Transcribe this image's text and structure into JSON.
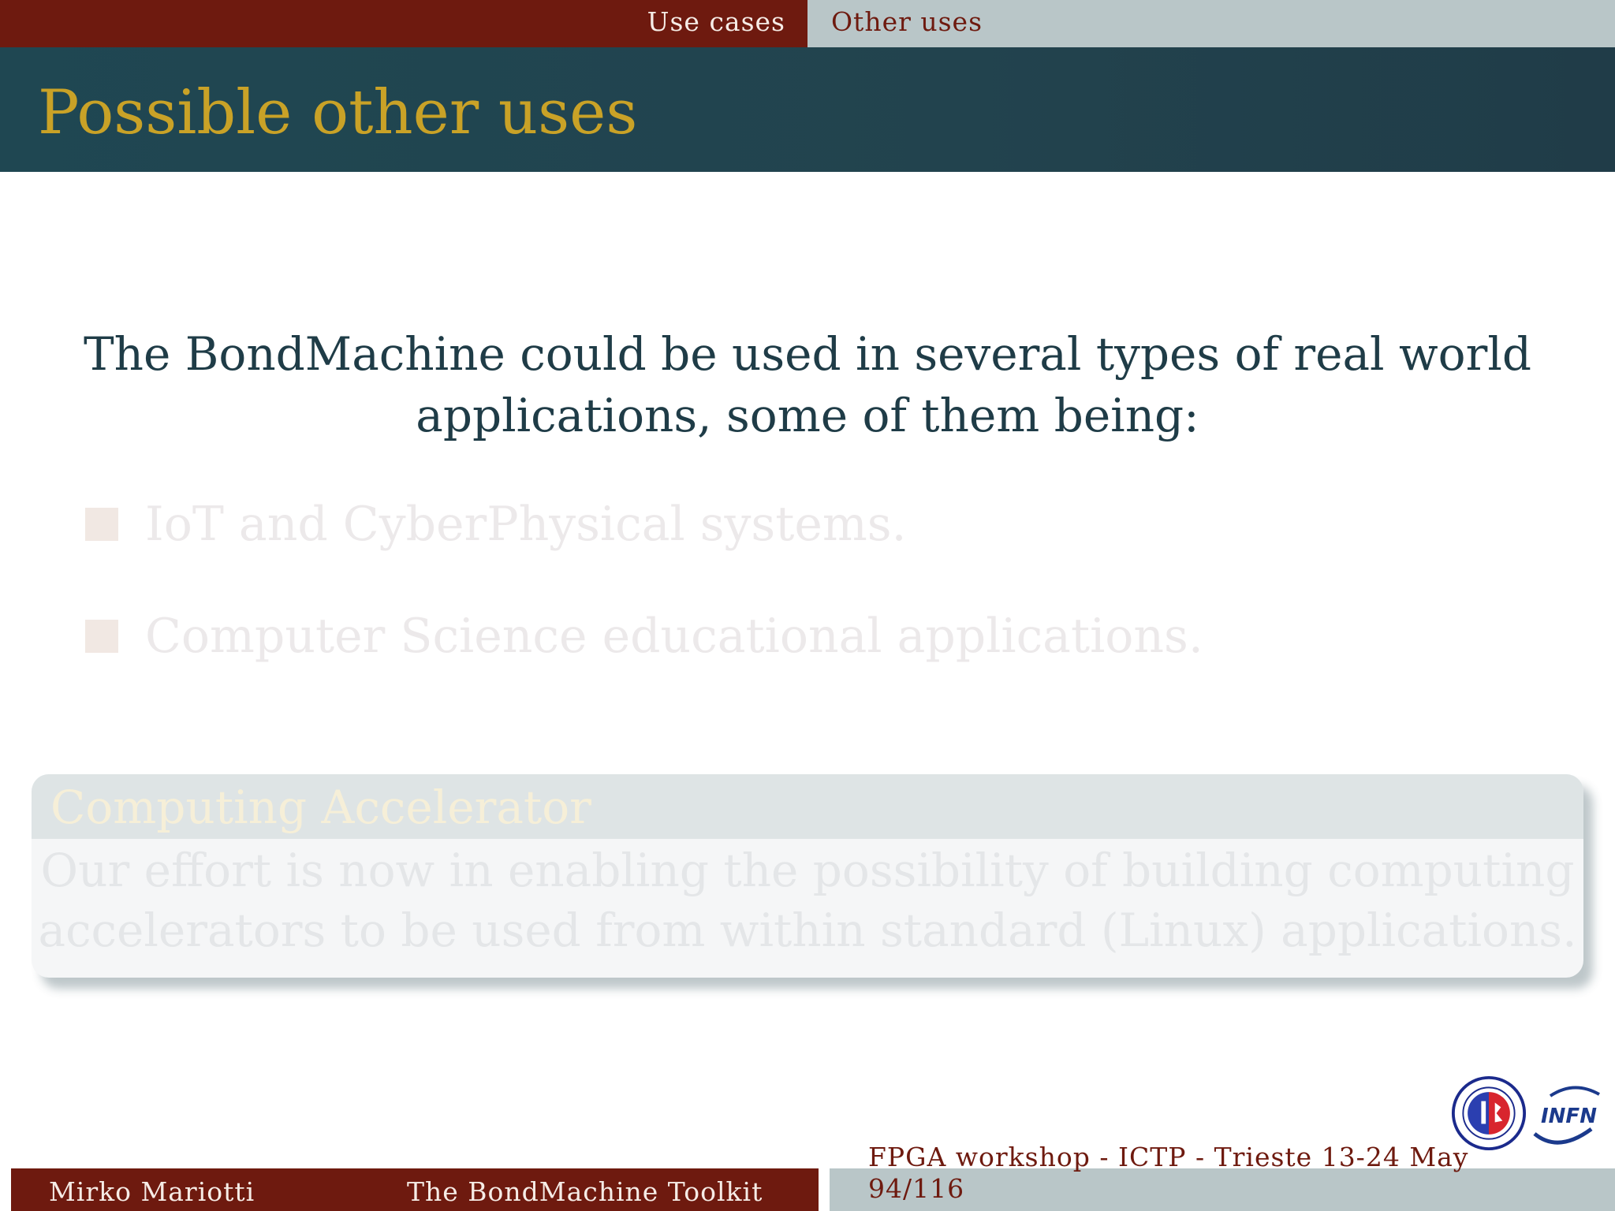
{
  "nav": {
    "section": "Use cases",
    "subsection": "Other uses"
  },
  "slide": {
    "title": "Possible other uses",
    "intro_line1": "The BondMachine could be used in several types of real world",
    "intro_line2": "applications, some of them being:",
    "bullets": [
      {
        "text": "IoT and CyberPhysical systems."
      },
      {
        "text": "Computer Science educational applications."
      }
    ],
    "block": {
      "title": "Computing Accelerator",
      "body_line1": "Our effort is now in enabling the possibility of building computing",
      "body_line2": "accelerators to be used from within standard (Linux) applications."
    }
  },
  "logos": {
    "seal": "university-seal-logo",
    "infn": "INFN"
  },
  "footer": {
    "author": "Mirko Mariotti",
    "title": "The BondMachine Toolkit",
    "event": "FPGA workshop - ICTP - Trieste 13-24 May",
    "page": "94/116"
  },
  "colors": {
    "dark_red": "#6e1a0f",
    "teal": "#1f4752",
    "gold": "#c9a227",
    "light_grey": "#b9c6c8"
  }
}
